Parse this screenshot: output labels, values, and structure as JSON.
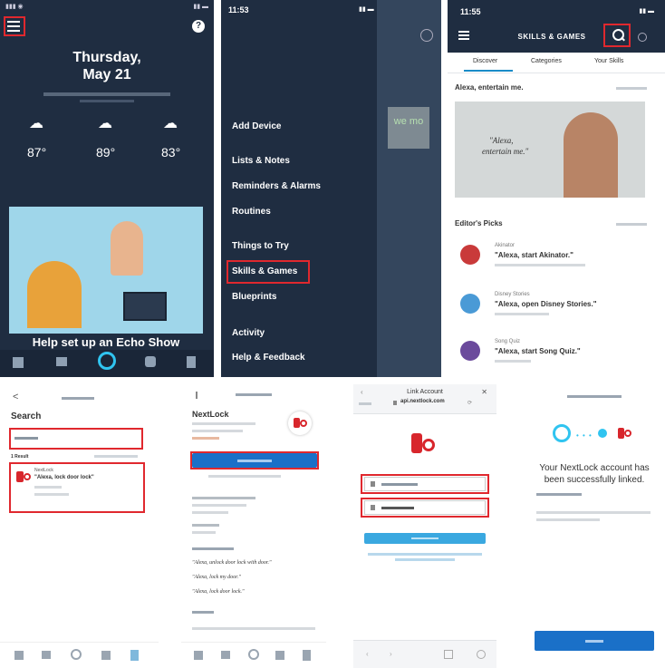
{
  "p1": {
    "day": "Thursday,",
    "date": "May 21",
    "temps": [
      "87°",
      "89°",
      "83°"
    ],
    "banner_title": "Help set up an Echo Show",
    "help_icon": "?"
  },
  "p2": {
    "time": "11:53",
    "menu_items": [
      "Add Device",
      "Lists & Notes",
      "Reminders & Alarms",
      "Routines",
      "Things to Try",
      "Skills & Games",
      "Blueprints",
      "Activity",
      "Help & Feedback"
    ],
    "wemo_logo": "we mo"
  },
  "p3": {
    "time": "11:55",
    "title": "SKILLS & GAMES",
    "tabs": [
      "Discover",
      "Categories",
      "Your Skills"
    ],
    "section1": "Alexa, entertain me.",
    "hero_quote_line1": "\"Alexa,",
    "hero_quote_line2": "entertain me.\"",
    "section2": "Editor's Picks",
    "picks": [
      {
        "name": "Akinator",
        "quote": "\"Alexa, start Akinator.\""
      },
      {
        "name": "Disney Stories",
        "quote": "\"Alexa, open Disney Stories.\""
      },
      {
        "name": "Song Quiz",
        "quote": "\"Alexa, start Song Quiz.\""
      }
    ]
  },
  "p4": {
    "back": "<",
    "heading": "Search",
    "result_count": "1 Result",
    "result_name": "NextLock",
    "result_quote": "\"Alexa, lock door lock\""
  },
  "p5": {
    "title": "NextLock",
    "quotes": [
      "\"Alexa, unlock door lock with door.\"",
      "\"Alexa, lock my door.\"",
      "\"Alexa, lock door lock.\""
    ]
  },
  "p6": {
    "title": "Link Account",
    "url": "api.nextlock.com",
    "close": "✕"
  },
  "p7": {
    "message": "Your NextLock account has been successfully linked."
  },
  "colors": {
    "highlight": "#e0282e",
    "navy": "#1d2b3e",
    "alexa_blue": "#30c4f0",
    "cta_blue": "#1a70c8"
  }
}
